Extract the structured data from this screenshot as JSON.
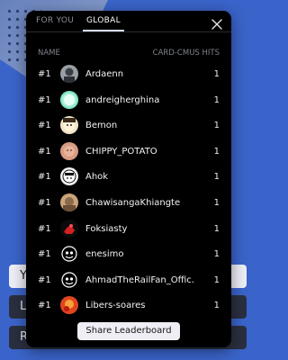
{
  "background": {
    "button_1": "Y",
    "button_2": "L",
    "button_3": "R"
  },
  "tabs": [
    {
      "label": "FOR YOU"
    },
    {
      "label": "GLOBAL"
    }
  ],
  "columns": {
    "name": "NAME",
    "hits": "CARD-CMUS HITS"
  },
  "rows": [
    {
      "rank": "#1",
      "name": "Ardaenn",
      "hits": "1",
      "avatar": "gray-portrait"
    },
    {
      "rank": "#1",
      "name": "andreigherghina",
      "hits": "1",
      "avatar": "mint-orb"
    },
    {
      "rank": "#1",
      "name": "Bemon",
      "hits": "1",
      "avatar": "cartoon-face"
    },
    {
      "rank": "#1",
      "name": "CHIPPY_POTATO",
      "hits": "1",
      "avatar": "peach-face"
    },
    {
      "rank": "#1",
      "name": "Ahok",
      "hits": "1",
      "avatar": "white-face"
    },
    {
      "rank": "#1",
      "name": "ChawisangaKhiangte",
      "hits": "1",
      "avatar": "tan-portrait"
    },
    {
      "rank": "#1",
      "name": "Foksiasty",
      "hits": "1",
      "avatar": "red-figure"
    },
    {
      "rank": "#1",
      "name": "enesimo",
      "hits": "1",
      "avatar": "white-emblem"
    },
    {
      "rank": "#1",
      "name": "AhmadTheRailFan_Offic...",
      "hits": "1",
      "avatar": "white-emblem"
    },
    {
      "rank": "#1",
      "name": "Libers-soares",
      "hits": "1",
      "avatar": "orange-red"
    }
  ],
  "share_label": "Share Leaderboard"
}
